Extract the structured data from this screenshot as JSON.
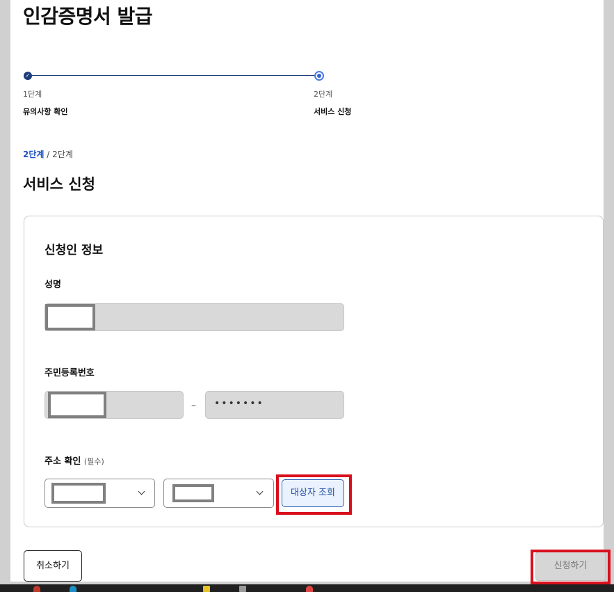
{
  "page_title": "인감증명서 발급",
  "stepper": {
    "steps": [
      {
        "num": "1단계",
        "name": "유의사항 확인",
        "done_mark": "✓"
      },
      {
        "num": "2단계",
        "name": "서비스 신청"
      }
    ]
  },
  "breadcrumb": {
    "current": "2단계",
    "separator": " / ",
    "total": "2단계"
  },
  "section_title": "서비스 신청",
  "applicant_card": {
    "title": "신청인 정보",
    "name_label": "성명",
    "rrn_label": "주민등록번호",
    "rrn_dash": "–",
    "rrn_back_masked": "•••••••",
    "address_label": "주소 확인",
    "address_required": "(필수)",
    "lookup_button": "대상자 조회"
  },
  "footer": {
    "cancel": "취소하기",
    "apply": "신청하기"
  },
  "colors": {
    "accent": "#1c3d7a",
    "highlight": "#d8101c",
    "link": "#1b4fbf"
  }
}
